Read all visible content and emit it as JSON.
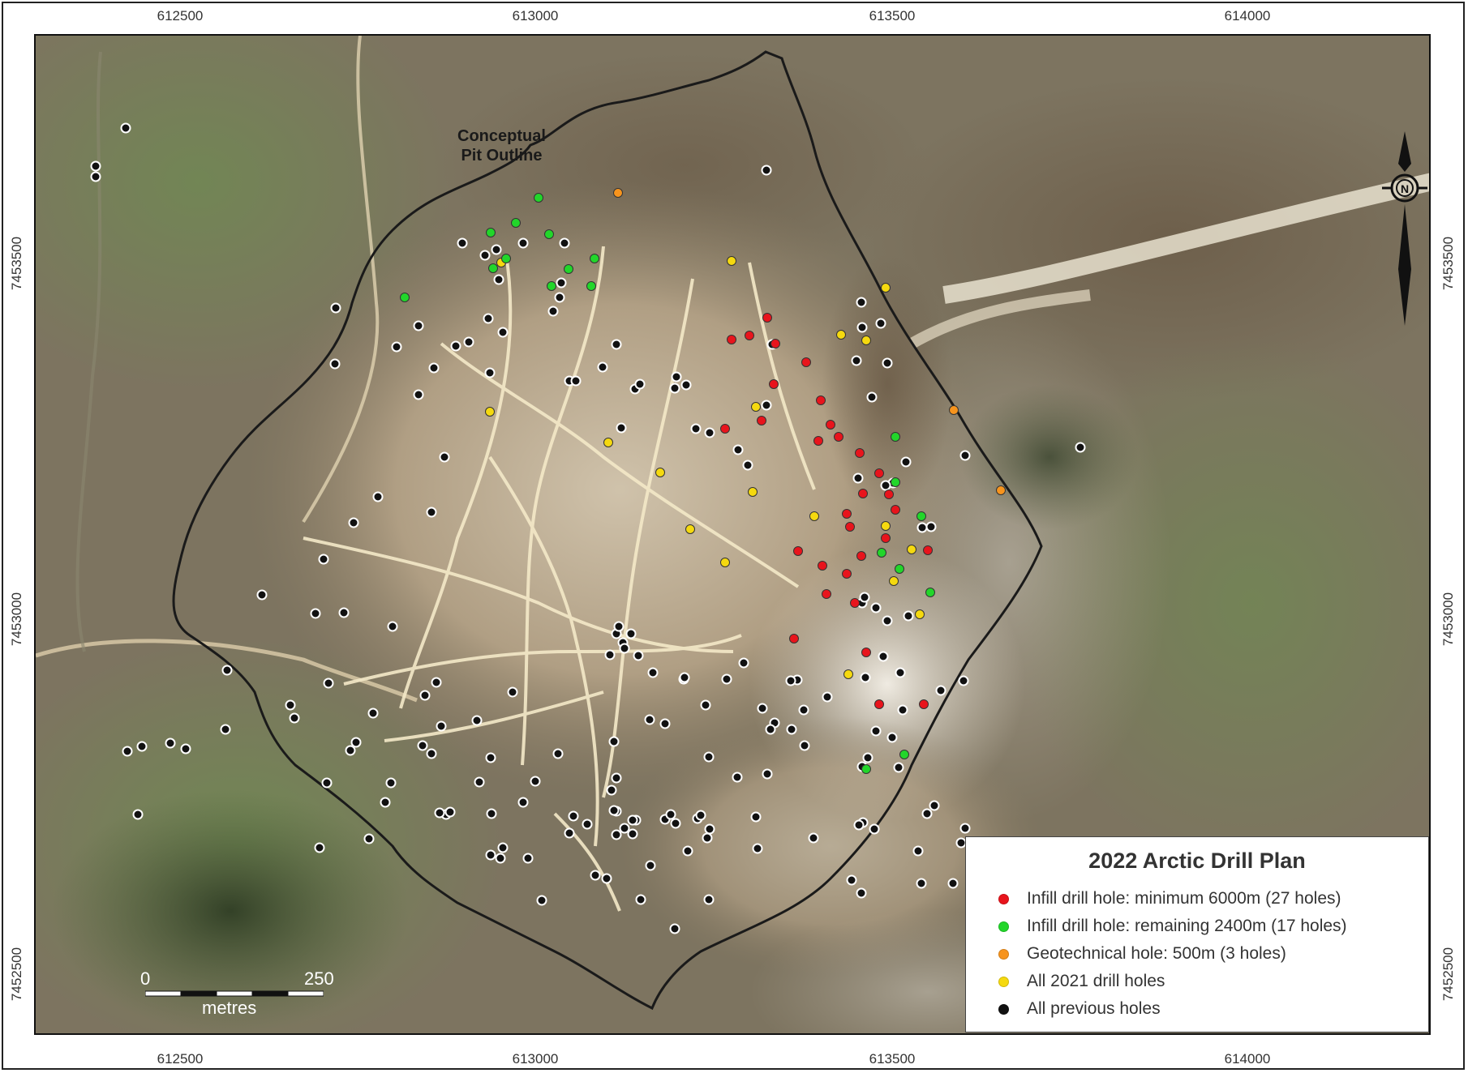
{
  "map": {
    "title": "2022 Arctic Drill Plan",
    "pit_label": [
      "Conceptual",
      "Pit Outline"
    ],
    "x_ticks": [
      "612500",
      "613000",
      "613500",
      "614000"
    ],
    "y_ticks": [
      "7453500",
      "7453000",
      "7452500"
    ],
    "scale": {
      "zero": "0",
      "max": "250",
      "unit": "metres"
    },
    "legend": [
      {
        "label": "Infill drill hole: minimum 6000m (27 holes)",
        "color": "#e8141c"
      },
      {
        "label": "Infill drill hole: remaining 2400m (17 holes)",
        "color": "#22d62a"
      },
      {
        "label": "Geotechnical hole: 500m (3 holes)",
        "color": "#f7941d"
      },
      {
        "label": "All 2021 drill holes",
        "color": "#f5d90f"
      },
      {
        "label": "All previous holes",
        "color": "#111111"
      }
    ],
    "north_symbol": "compass-rose-icon"
  }
}
